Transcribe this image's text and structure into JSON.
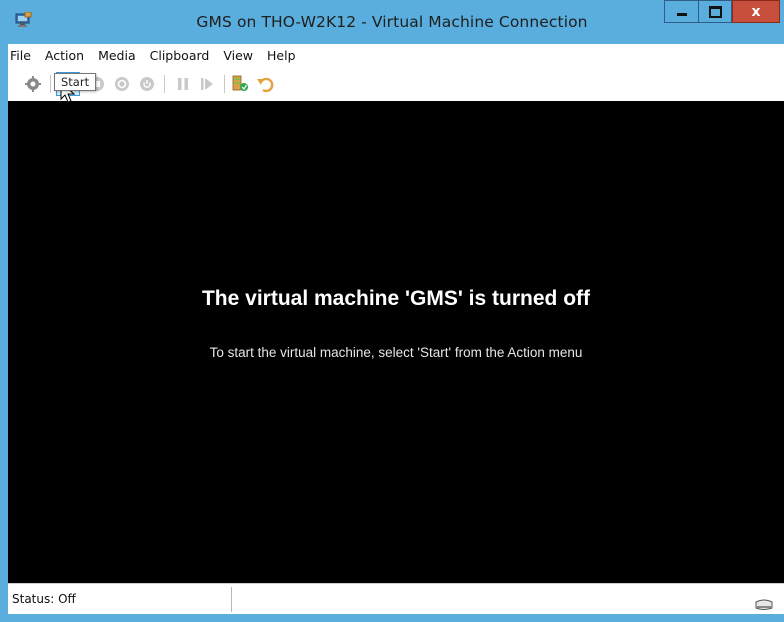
{
  "window": {
    "title": "GMS on THO-W2K12 - Virtual Machine Connection",
    "close_label": "x"
  },
  "menu": [
    "File",
    "Action",
    "Media",
    "Clipboard",
    "View",
    "Help"
  ],
  "toolbar": {
    "icons": [
      "ctrl-alt-del-icon",
      "start-icon",
      "turn-off-icon",
      "shut-down-icon",
      "save-icon",
      "pause-icon",
      "reset-icon",
      "checkpoint-icon",
      "revert-icon"
    ],
    "active": "start-icon"
  },
  "tooltip": {
    "text": "Start"
  },
  "screen": {
    "heading": "The virtual machine 'GMS' is turned off",
    "subtext": "To start the virtual machine, select 'Start' from the Action menu"
  },
  "status": {
    "text": "Status: Off"
  },
  "colors": {
    "frame": "#5aaede",
    "close": "#c74f3b",
    "screen": "#000000",
    "start_green": "#1fa84f"
  }
}
